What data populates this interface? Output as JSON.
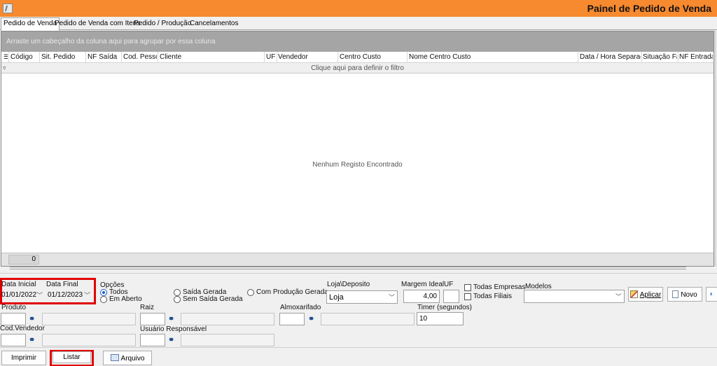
{
  "window": {
    "title": "Painel de Pedido de Venda"
  },
  "tabs": [
    "Pedido de Venda",
    "Pedido de Venda com Itens",
    "Pedido / Produção",
    "Cancelamentos"
  ],
  "grid": {
    "group_hint": "Arraste um cabeçalho da coluna aqui para agrupar por essa coluna",
    "columns": [
      "Código",
      "Sit. Pedido",
      "NF Saída",
      "Cod. Pessoa",
      "Cliente",
      "UF",
      "Vendedor",
      "Centro Custo",
      "Nome Centro Custo",
      "Data / Hora Separação",
      "Situação Fat",
      "NF Entrada"
    ],
    "filter_hint": "Clique aqui para definir o filtro",
    "empty_message": "Nenhum Registo Encontrado",
    "footer_count": "0"
  },
  "filters": {
    "data_inicial_label": "Data Inicial",
    "data_inicial_value": "01/01/2022",
    "data_final_label": "Data Final",
    "data_final_value": "01/12/2023",
    "opcoes_label": "Opções",
    "options": {
      "todos": "Todos",
      "em_aberto": "Em Aberto",
      "saida_gerada": "Saída Gerada",
      "sem_saida_gerada": "Sem Saída Gerada",
      "com_producao_gerada": "Com Produção Gerada"
    },
    "loja_label": "Loja\\Deposito",
    "loja_value": "Loja",
    "margem_label": "Margem Ideal",
    "margem_value": "4,00",
    "uf_label": "UF",
    "todas_empresas": "Todas Empresas",
    "todas_filiais": "Todas Filiais",
    "modelos_label": "Modelos",
    "aplicar_label": "Aplicar",
    "novo_label": "Novo",
    "produto_label": "Produto",
    "raiz_label": "Raiz",
    "almoxarifado_label": "Almoxarifado",
    "timer_label": "Timer (segundos)",
    "timer_value": "10",
    "cod_vendedor_label": "Cod.Vendedor",
    "usuario_label": "Usuário Responsável"
  },
  "actions": {
    "imprimir": "Imprimir",
    "listar": "Listar",
    "arquivo": "Arquivo"
  },
  "colors": {
    "titlebar": "#f7892e",
    "highlight": "#e00000"
  }
}
